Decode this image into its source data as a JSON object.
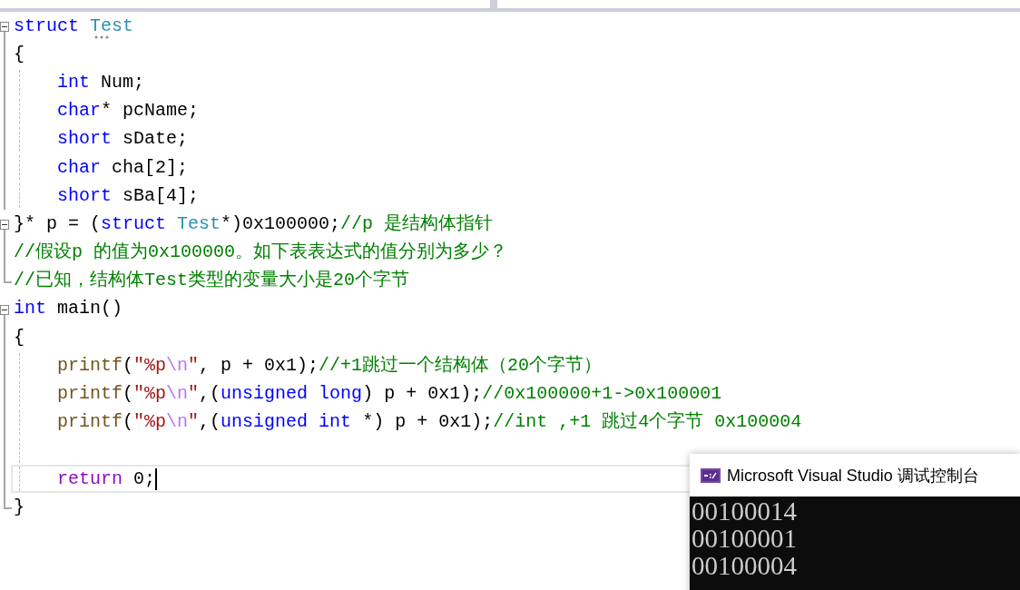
{
  "editor": {
    "lines": [
      {
        "fold": {
          "kind": "box",
          "expanded": true
        },
        "current": false,
        "tokens": [
          {
            "kind": "keyword",
            "text": "struct"
          },
          {
            "kind": "type",
            "text": " Test",
            "hint": true
          }
        ]
      },
      {
        "fold": {
          "kind": "bar"
        },
        "current": false,
        "tokens": [
          {
            "kind": "plain",
            "text": "{"
          }
        ],
        "children": [
          {
            "fold": {
              "kind": "bar"
            },
            "current": false,
            "tokens": [
              {
                "kind": "keyword",
                "text": "int"
              },
              {
                "kind": "plain",
                "text": " Num;"
              }
            ]
          },
          {
            "fold": {
              "kind": "bar"
            },
            "current": false,
            "tokens": [
              {
                "kind": "keyword",
                "text": "char"
              },
              {
                "kind": "plain",
                "text": "* pcName;"
              }
            ]
          },
          {
            "fold": {
              "kind": "bar"
            },
            "current": false,
            "tokens": [
              {
                "kind": "keyword",
                "text": "short"
              },
              {
                "kind": "plain",
                "text": " sDate;"
              }
            ]
          },
          {
            "fold": {
              "kind": "bar"
            },
            "current": false,
            "tokens": [
              {
                "kind": "keyword",
                "text": "char"
              },
              {
                "kind": "plain",
                "text": " cha[2];"
              }
            ]
          },
          {
            "fold": {
              "kind": "bar"
            },
            "current": false,
            "tokens": [
              {
                "kind": "keyword",
                "text": "short"
              },
              {
                "kind": "plain",
                "text": " sBa[4];"
              }
            ]
          }
        ]
      },
      {
        "fold": {
          "kind": "box",
          "expanded": true
        },
        "current": false,
        "tokens": [
          {
            "kind": "plain",
            "text": "}* p = ("
          },
          {
            "kind": "keyword",
            "text": "struct"
          },
          {
            "kind": "type",
            "text": " Test"
          },
          {
            "kind": "plain",
            "text": "*)0x100000;"
          },
          {
            "kind": "comment",
            "text": "//p 是结构体指针"
          }
        ]
      },
      {
        "fold": {
          "kind": "bar"
        },
        "current": false,
        "tokens": [
          {
            "kind": "comment",
            "text": "//假设p 的值为0x100000。如下表表达式的值分别为多少？"
          }
        ]
      },
      {
        "fold": {
          "kind": "end"
        },
        "current": false,
        "tokens": [
          {
            "kind": "comment",
            "text": "//已知，结构体Test类型的变量大小是20个字节"
          }
        ]
      },
      {
        "fold": {
          "kind": "box",
          "expanded": true
        },
        "current": false,
        "tokens": [
          {
            "kind": "keyword",
            "text": "int"
          },
          {
            "kind": "plain",
            "text": " main()"
          }
        ]
      },
      {
        "fold": {
          "kind": "bar"
        },
        "current": false,
        "tokens": [
          {
            "kind": "plain",
            "text": "{"
          }
        ],
        "children": [
          {
            "fold": {
              "kind": "bar"
            },
            "current": false,
            "tokens": [
              {
                "kind": "function",
                "text": "printf"
              },
              {
                "kind": "plain",
                "text": "("
              },
              {
                "kind": "string",
                "text": "\"%p"
              },
              {
                "kind": "escape",
                "text": "\\n"
              },
              {
                "kind": "string",
                "text": "\""
              },
              {
                "kind": "plain",
                "text": ", p + 0x1);"
              },
              {
                "kind": "comment",
                "text": "//+1跳过一个结构体（20个字节）"
              }
            ]
          },
          {
            "fold": {
              "kind": "bar"
            },
            "current": false,
            "tokens": [
              {
                "kind": "function",
                "text": "printf"
              },
              {
                "kind": "plain",
                "text": "("
              },
              {
                "kind": "string",
                "text": "\"%p"
              },
              {
                "kind": "escape",
                "text": "\\n"
              },
              {
                "kind": "string",
                "text": "\""
              },
              {
                "kind": "plain",
                "text": ",("
              },
              {
                "kind": "keyword",
                "text": "unsigned long"
              },
              {
                "kind": "plain",
                "text": ") p + 0x1);"
              },
              {
                "kind": "comment",
                "text": "//0x100000+1->0x100001"
              }
            ]
          },
          {
            "fold": {
              "kind": "bar"
            },
            "current": false,
            "tokens": [
              {
                "kind": "function",
                "text": "printf"
              },
              {
                "kind": "plain",
                "text": "("
              },
              {
                "kind": "string",
                "text": "\"%p"
              },
              {
                "kind": "escape",
                "text": "\\n"
              },
              {
                "kind": "string",
                "text": "\""
              },
              {
                "kind": "plain",
                "text": ",("
              },
              {
                "kind": "keyword",
                "text": "unsigned int"
              },
              {
                "kind": "plain",
                "text": " *) p + 0x1);"
              },
              {
                "kind": "comment",
                "text": "//int ,+1 跳过4个字节 0x100004"
              }
            ]
          },
          {
            "fold": {
              "kind": "bar"
            },
            "current": false
          },
          {
            "fold": {
              "kind": "bar"
            },
            "current": true,
            "tokens": [
              {
                "kind": "control",
                "text": "return"
              },
              {
                "kind": "plain",
                "text": " 0;"
              }
            ]
          }
        ]
      },
      {
        "fold": {
          "kind": "end"
        },
        "current": false,
        "tokens": [
          {
            "kind": "plain",
            "text": "}"
          }
        ]
      }
    ]
  },
  "console": {
    "title": "Microsoft Visual Studio 调试控制台",
    "output": [
      "00100014",
      "00100001",
      "00100004"
    ]
  }
}
